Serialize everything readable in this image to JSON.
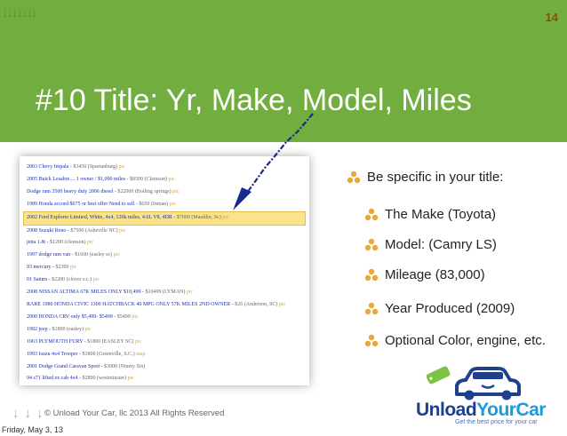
{
  "slide": {
    "number": "14",
    "title": "#10 Title: Yr, Make, Model, Miles",
    "bullets": [
      "Be specific in your title:",
      "The Make (Toyota)",
      "Model: (Camry LS)",
      "Mileage (83,000)",
      "Year Produced (2009)",
      "Optional Color, engine, etc."
    ],
    "footer": "© Unload Your Car, llc 2013 All Rights Reserved",
    "logo": {
      "part1": "Unload",
      "part2": "YourCar",
      "tagline": "Get the best price for your car"
    }
  },
  "listings": [
    {
      "title": "2003 Chevy Impala",
      "price": "$3450",
      "loc": "(Spartanburg)",
      "pic": "pic"
    },
    {
      "title": "2005 Buick Lesabre.... 1 owner / $1,000 miles",
      "price": "$8500",
      "loc": "(Clemson)",
      "pic": "pic"
    },
    {
      "title": "Dodge ram 3500 heavy duty 2006 diesel",
      "price": "$22000",
      "loc": "(Boiling springs)",
      "pic": "pic"
    },
    {
      "title": "1989 Honda accord $675 or best offer Need to sell",
      "price": "$650",
      "loc": "(Inman)",
      "pic": "pic"
    },
    {
      "title": "2002 Ford Explorer Limited, White, 4x4, 120k miles, 4.6L V8, 4DR",
      "price": "$7000",
      "loc": "(Mauldin, Sc)",
      "pic": "pic"
    },
    {
      "title": "2008 Suzuki Reno",
      "price": "$7500",
      "loc": "(Asheville NC)",
      "pic": "pic"
    },
    {
      "title": "jetta 1.8t",
      "price": "$1200",
      "loc": "(clemson)",
      "pic": "pic"
    },
    {
      "title": "1997 dodge ram van",
      "price": "$1600",
      "loc": "(easley sc)",
      "pic": "pic"
    },
    {
      "title": "93 mercury",
      "price": "$2300",
      "loc": "",
      "pic": "pic"
    },
    {
      "title": "01 Saturn",
      "price": "$2200",
      "loc": "(clover s.c.)",
      "pic": "pic"
    },
    {
      "title": "2008 NISSAN ALTIMA 67K MILES ONLY $10,499",
      "price": "$10499",
      "loc": "(LYMAN)",
      "pic": "pic"
    },
    {
      "title": "RARE 1980 HONDA CIVIC 1300 HATCHBACK 40 MPG ONLY 57K MILES 2ND OWNER",
      "price": "$26",
      "loc": "(Anderson, SC)",
      "pic": "pic"
    },
    {
      "title": "2000 HONDA CRV only $5,499- $5499",
      "price": "$5499",
      "loc": "",
      "pic": "pic"
    },
    {
      "title": "1992 jeep",
      "price": "$1800",
      "loc": "(easley)",
      "pic": "pic"
    },
    {
      "title": "1963 PLYMOUTH FURY",
      "price": "$1800",
      "loc": "(EASLEY SC)",
      "pic": "pic"
    },
    {
      "title": "1993 Isuzu 4x4 Trooper",
      "price": "$1800",
      "loc": "(Greenville, S.C.)",
      "pic": "map"
    },
    {
      "title": "2001 Dodge Grand Caravan Sport",
      "price": "$3000",
      "loc": "(Ninety Six)",
      "pic": ""
    },
    {
      "title": "94 s71 lifted ex cab 4x4",
      "price": "$2800",
      "loc": "(westminster)",
      "pic": "pic"
    }
  ],
  "date": "Friday, May 3, 13",
  "colors": {
    "green": "#72ad3f",
    "bullet": "#e8a93a",
    "highlight": "#fbe38a",
    "title": "#ffffff"
  },
  "icons": [
    "down-arrows-icon",
    "bullet-cluster-icon",
    "pointer-arrow-icon",
    "car-logo-icon"
  ]
}
